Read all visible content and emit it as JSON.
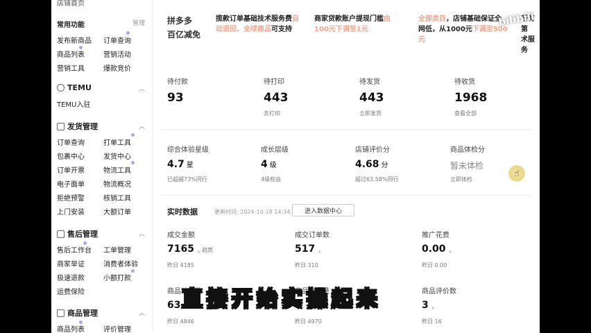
{
  "sidebar": {
    "top_cut_label": "店铺首页",
    "common_title": "常用功能",
    "manage_label": "管理",
    "common_items": [
      "发布新商品",
      "订单查询",
      "商品列表",
      "营销活动",
      "营销工具",
      "爆款竞价"
    ],
    "temu_title": "TEMU",
    "temu_items": [
      "TEMU入驻"
    ],
    "ship_title": "发货管理",
    "ship_items": [
      "订单查询",
      "打单工具",
      "包裹中心",
      "发货中心",
      "订单开票",
      "物流工具",
      "电子面单",
      "物流概况",
      "拒绝预警",
      "核销工具",
      "上门安装",
      "大额订单"
    ],
    "after_title": "售后管理",
    "after_items": [
      "售后工作台",
      "工单管理",
      "商家举证",
      "消费者体验",
      "极速退款",
      "小额打款",
      "运费保险"
    ],
    "goods_title": "商品管理",
    "goods_items": [
      "商品列表",
      "评价管理"
    ]
  },
  "banner": {
    "logo_line1": "拼多多",
    "logo_line2": "百亿减免",
    "col1_line1": "揽款订单基础技术服务费",
    "col1_hl1": "自",
    "col1_line2": "动退回，",
    "col1_hl2": "全球商品",
    "col1_tail": "可支持",
    "col2_line1": "商家贷款账户提现门槛",
    "col2_hl1": "由",
    "col2_line2": "100元下调至1元",
    "col3_line1_hl": "全部类目",
    "col3_line1": "，店铺基础保证全",
    "col3_line2": "网低，从1000元",
    "col3_hl2": "下调至500",
    "col3_line3": "元",
    "col4_line1": "所有第",
    "col4_line2": "术服务"
  },
  "orders": [
    {
      "label": "待付款",
      "value": "93",
      "sub": ""
    },
    {
      "label": "待打印",
      "value": "443",
      "sub": "去打印"
    },
    {
      "label": "待发货",
      "value": "443",
      "sub": "立即发货"
    },
    {
      "label": "待收货",
      "value": "1968",
      "sub": "查看全部"
    }
  ],
  "scores": {
    "experience": {
      "label": "综合体验星级",
      "value": "4.7",
      "unit": "星",
      "sub": "已超越73%同行"
    },
    "growth": {
      "label": "成长层级",
      "value": "4",
      "unit": "级",
      "sub": "4级权益"
    },
    "review": {
      "label": "店铺评价分",
      "value": "4.68",
      "unit": "分",
      "sub": "超过63.58%同行"
    },
    "goods_check": {
      "label": "商品体检分",
      "value": "暂未体检",
      "sub": "立即体检"
    }
  },
  "realtime": {
    "title": "实时数据",
    "updated": "更新时间: 2024-10-18 14:34:43",
    "button": "进入数据中心",
    "trend_label": "趋势",
    "metrics": [
      {
        "label": "成交金额",
        "value": "7165",
        "yesterday": "昨日 4185"
      },
      {
        "label": "成交订单数",
        "value": "517",
        "yesterday": "昨日 310"
      },
      {
        "label": "推广花费",
        "value": "0.00",
        "yesterday": "昨日 0.00"
      },
      {
        "label": "商品访客数",
        "value": "63",
        "yesterday": "昨日 4846"
      },
      {
        "label": "商品浏览量",
        "value": "",
        "yesterday": "昨日 4970"
      },
      {
        "label": "商品评价数",
        "value": "3",
        "yesterday": "昨日 16"
      }
    ]
  },
  "caption": "直接开始实操起来",
  "watermark": "bilibili",
  "colors": {
    "highlight": "#f4a58a",
    "caption": "#ffde1a",
    "badge_dot": "#b7a0e6"
  }
}
